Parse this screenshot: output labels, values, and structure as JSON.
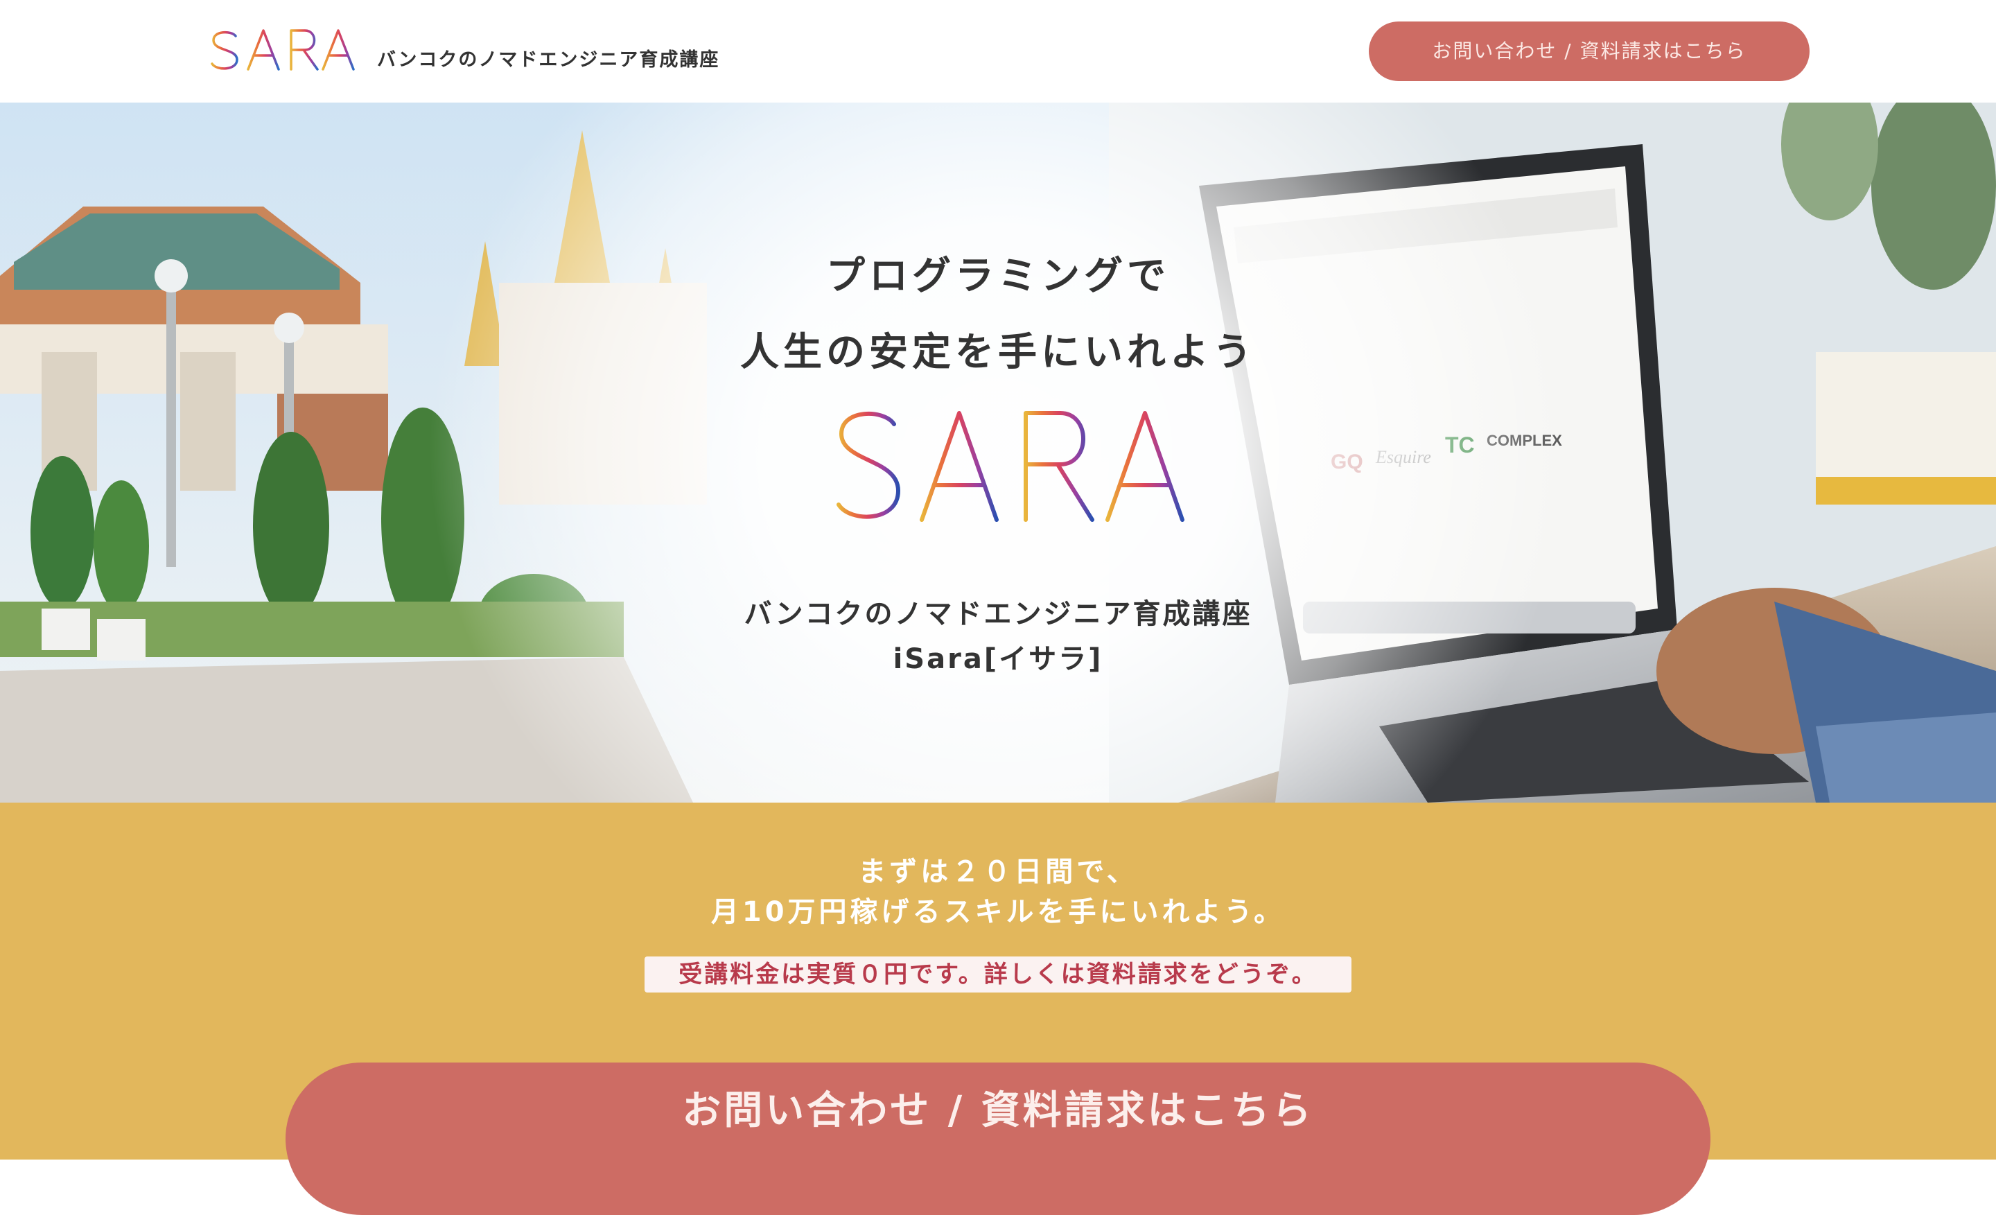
{
  "header": {
    "logo_text": "iSARA",
    "tagline": "バンコクのノマドエンジニア育成講座",
    "cta_label": "お問い合わせ / 資料請求はこちら"
  },
  "hero": {
    "heading_line1": "プログラミングで",
    "heading_line2": "人生の安定を手にいれよう",
    "logo_text": "iSARA",
    "sub_line1": "バンコクのノマドエンジニア育成講座",
    "sub_line2": "iSara[イサラ]",
    "screen_logos": [
      "GQ",
      "Esquire",
      "TC",
      "COMPLEX"
    ]
  },
  "promo": {
    "line1": "まずは２０日間で、",
    "line2": "月10万円稼げるスキルを手にいれよう。",
    "badge": "受講料金は実質０円です。詳しくは資料請求をどうぞ。",
    "cta_label": "お問い合わせ / 資料請求はこちら"
  },
  "colors": {
    "cta": "#cd6c64",
    "promo_bg": "#e2b75c",
    "badge_text": "#b83a4b",
    "logo_gradient": [
      "#e9b53b",
      "#e9733c",
      "#d9435f",
      "#9a3fa0",
      "#3f4fb0",
      "#2a6fc7"
    ]
  }
}
